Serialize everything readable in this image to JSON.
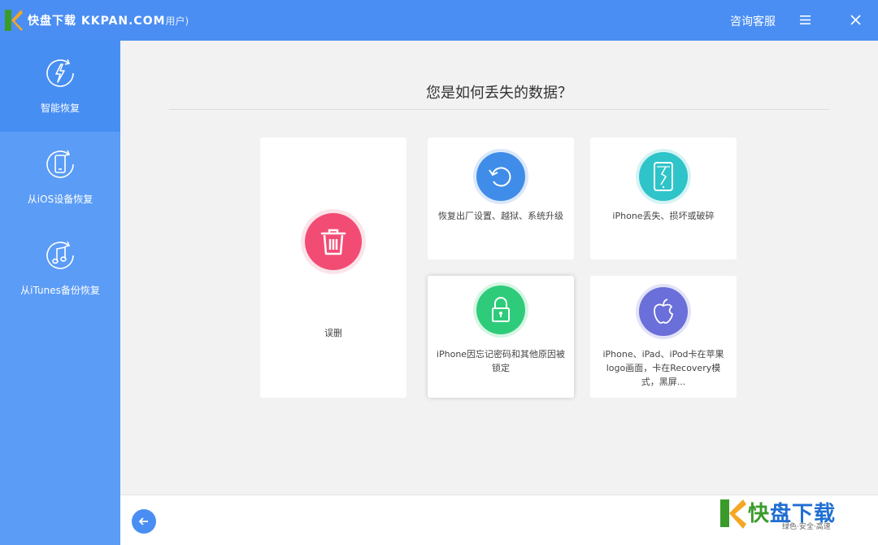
{
  "titlebar": {
    "watermark": "快盘下载 KKPAN.COM",
    "title_suffix": "用户)",
    "consult": "咨询客服"
  },
  "sidebar": {
    "items": [
      {
        "label": "智能恢复",
        "icon": "lightning-refresh-icon",
        "active": true
      },
      {
        "label": "从iOS设备恢复",
        "icon": "phone-refresh-icon",
        "active": false
      },
      {
        "label": "从iTunes备份恢复",
        "icon": "music-refresh-icon",
        "active": false
      }
    ]
  },
  "main": {
    "heading": "您是如何丢失的数据？",
    "cards": [
      {
        "label": "误删",
        "icon": "trash-icon",
        "color": "#f24c74"
      },
      {
        "label": "恢复出厂设置、越狱、系统升级",
        "icon": "restore-icon",
        "color": "#3f8de8"
      },
      {
        "label": "iPhone丢失、损坏或破碎",
        "icon": "broken-phone-icon",
        "color": "#2ec4c9"
      },
      {
        "label": "iPhone因忘记密码和其他原因被锁定",
        "icon": "lock-icon",
        "color": "#2ecc7a"
      },
      {
        "label": "iPhone、iPad、iPod卡在苹果logo画面，卡在Recovery模式，黑屏...",
        "icon": "apple-icon",
        "color": "#6b6fd9"
      }
    ]
  },
  "footer": {
    "back_icon": "arrow-left-icon"
  },
  "watermark_bottom": {
    "brand_a": "快",
    "brand_b": "盘下载",
    "tagline": "绿色·安全·高速"
  }
}
